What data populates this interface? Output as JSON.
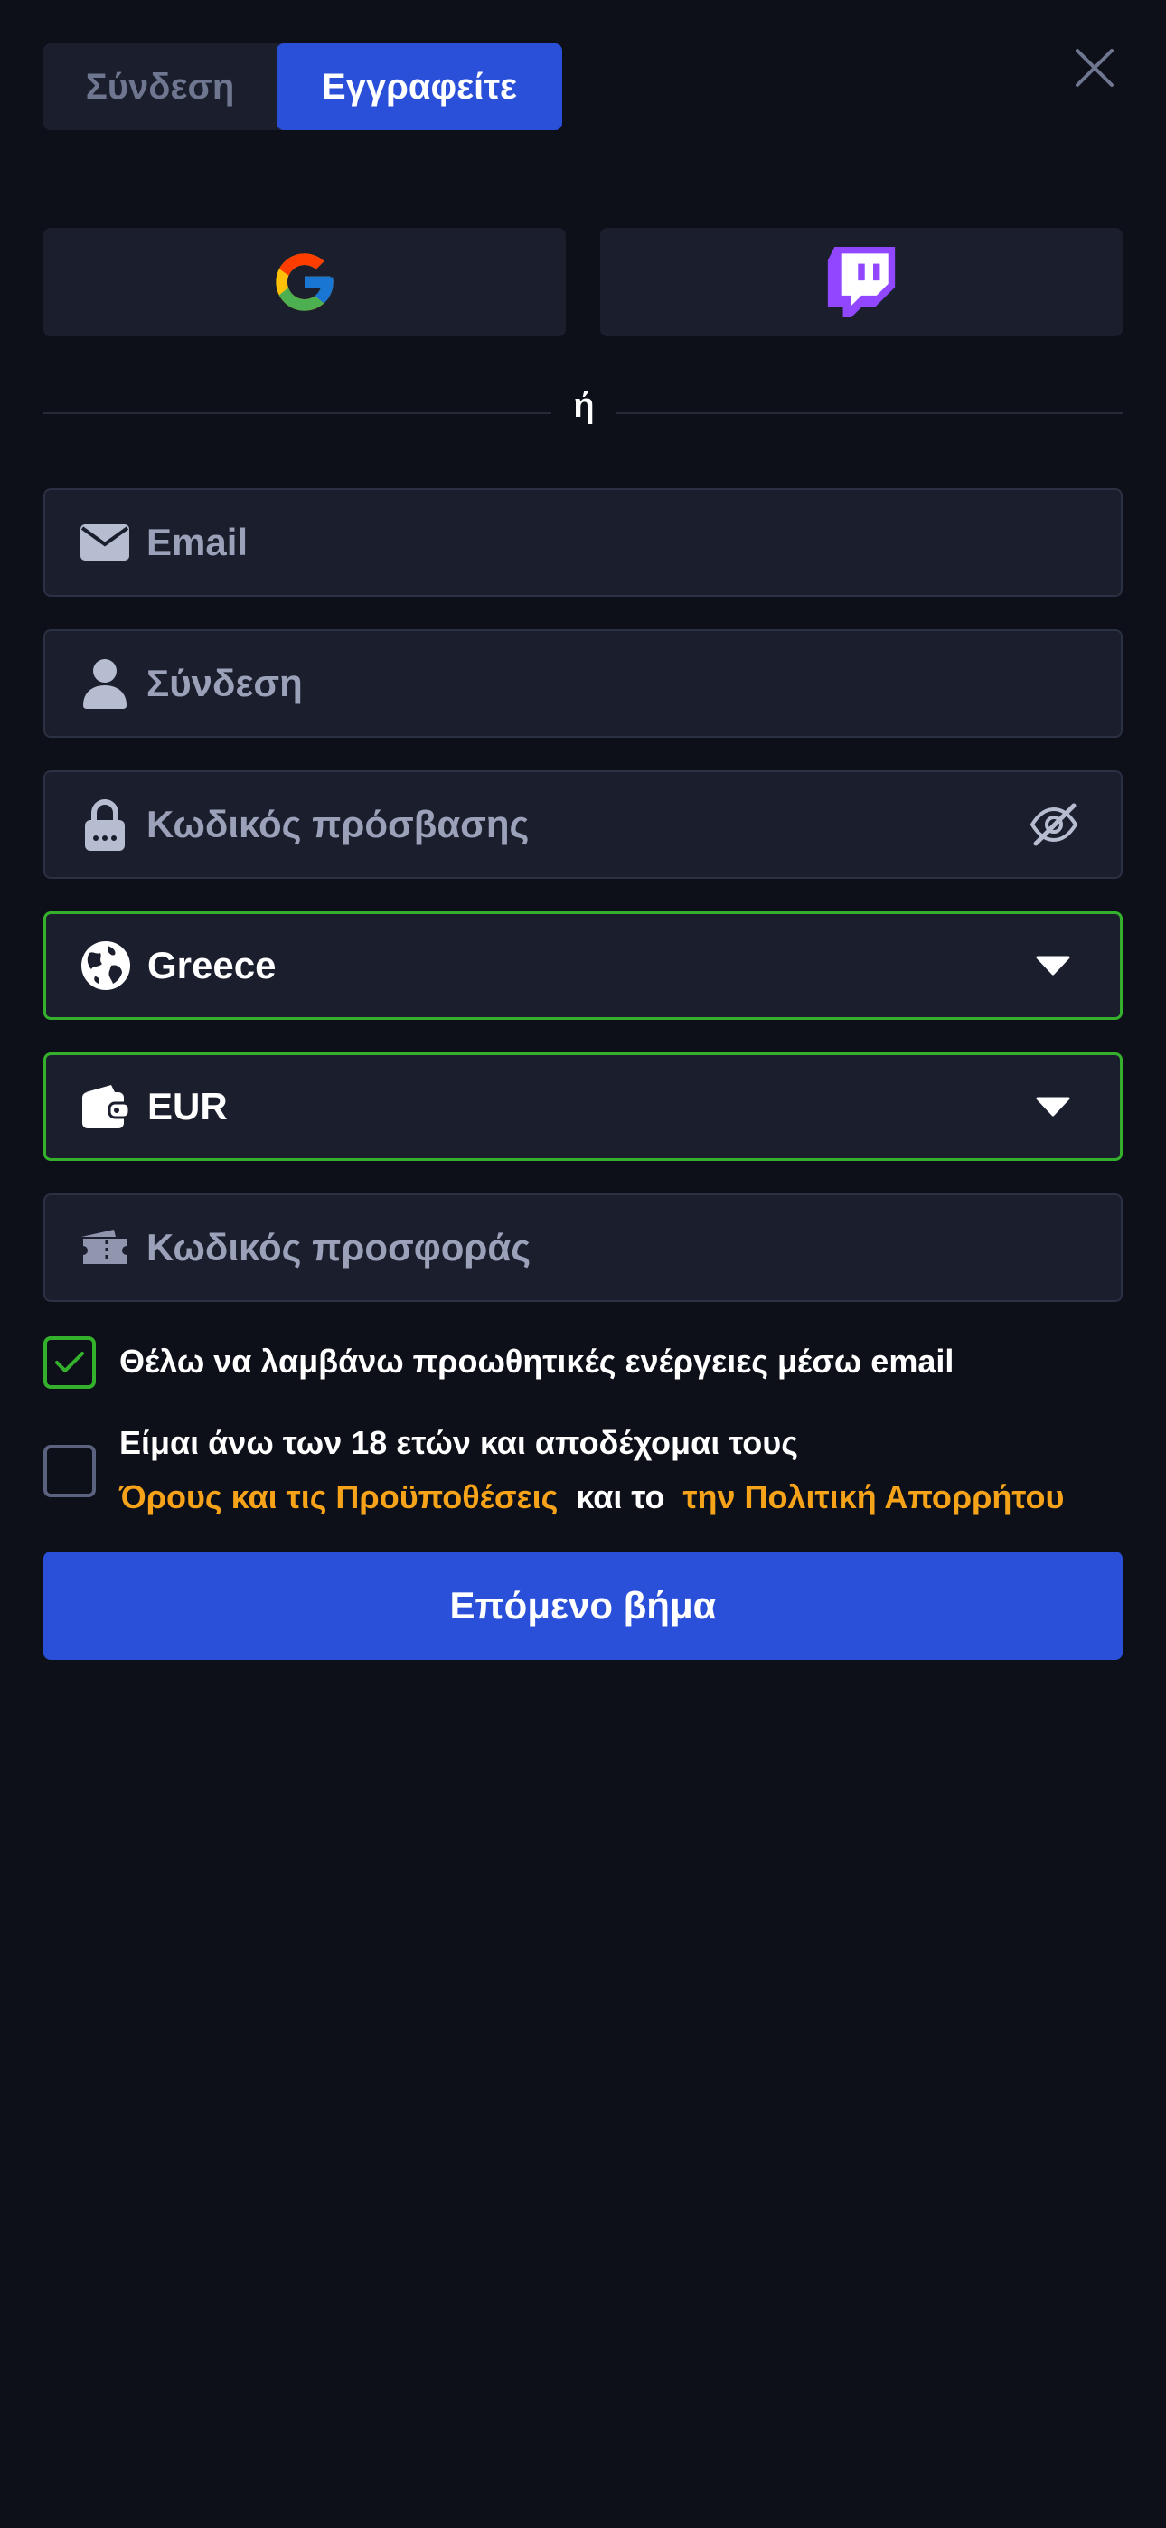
{
  "tabs": {
    "login_label": "Σύνδεση",
    "register_label": "Εγγραφείτε"
  },
  "social": {
    "google_icon": "google-logo-icon",
    "twitch_icon": "twitch-logo-icon"
  },
  "divider": {
    "text": "ή"
  },
  "form": {
    "email_placeholder": "Email",
    "login_placeholder": "Σύνδεση",
    "password_placeholder": "Κωδικός πρόσβασης",
    "country_value": "Greece",
    "currency_value": "EUR",
    "promo_placeholder": "Κωδικός προσφοράς"
  },
  "consents": {
    "promo_email_label": "Θέλω να λαμβάνω προωθητικές ενέργειες μέσω email",
    "promo_email_checked": true,
    "age_label": "Είμαι άνω των 18 ετών και αποδέχομαι τους",
    "terms_link": "Όρους και τις Προϋποθέσεις",
    "and_text": "και το",
    "privacy_link": "την Πολιτική Απορρήτου",
    "age_checked": false
  },
  "next_button_label": "Επόμενο βήμα",
  "colors": {
    "background": "#0e1019",
    "accent_blue": "#2a4fd9",
    "valid_green": "#35b02d",
    "link_orange": "#f6a31a"
  }
}
